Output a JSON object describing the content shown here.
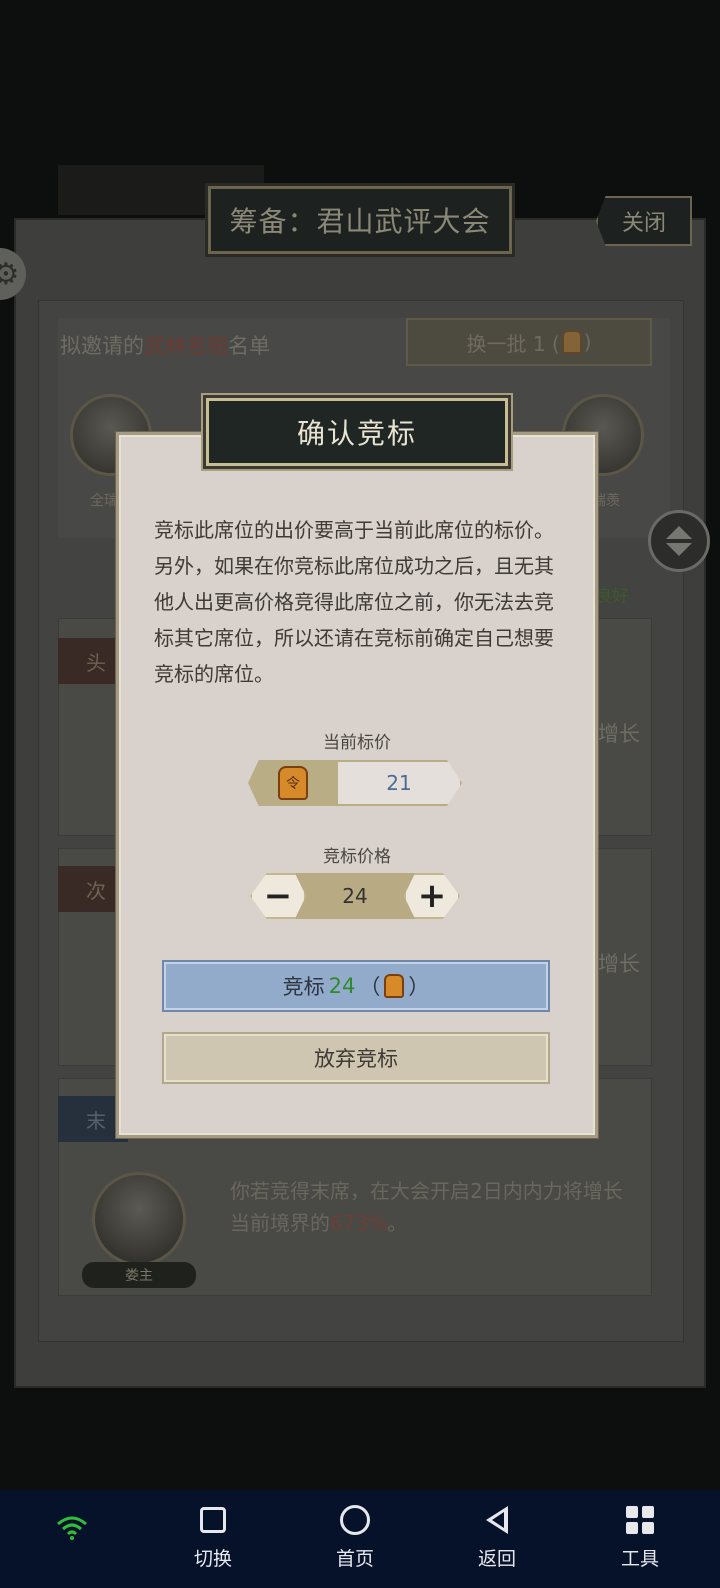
{
  "background": {
    "title": "筹备：君山武评大会",
    "close_label": "关闭",
    "invite_prefix": "拟邀请的",
    "invite_highlight": "武林名宿",
    "invite_suffix": "名单",
    "refresh_label": "换一批 1 (",
    "refresh_close": ")",
    "avatar_left_name": "全瑞",
    "avatar_right_name": "瑞羡",
    "status_label": "：",
    "status_value": "良好",
    "section_head_tag": "头",
    "section_second_tag": "次",
    "section_end_tag": "末",
    "grow_text_1": "增长",
    "grow_text_2": "增长",
    "end_desc_line1": "你若竞得末席，在大会开启2日内内力将增长",
    "end_desc_line2_prefix": "当前境界的",
    "end_desc_percent": "673%",
    "end_desc_line2_suffix": "。",
    "end_avatar_name": "娄主"
  },
  "modal": {
    "title": "确认竞标",
    "description": "竞标此席位的出价要高于当前此席位的标价。另外，如果在你竞标此席位成功之后，且无其他人出更高价格竞得此席位之前，你无法去竞标其它席位，所以还请在竞标前确定自己想要竞标的席位。",
    "current_price_label": "当前标价",
    "current_price_value": "21",
    "bid_price_label": "竞标价格",
    "bid_price_value": "24",
    "minus_symbol": "−",
    "plus_symbol": "+",
    "bid_button_prefix": "竞标",
    "bid_button_amount": "24",
    "bid_button_paren_open": "（",
    "bid_button_paren_close": "）",
    "give_up_label": "放弃竞标",
    "currency_icon": "gold-token-icon"
  },
  "navbar": {
    "switch_label": "切换",
    "home_label": "首页",
    "back_label": "返回",
    "tools_label": "工具"
  },
  "colors": {
    "bid_button": "#93abcb",
    "status_good": "#3f5a2a",
    "bid_amount": "#2e8a2e",
    "percent": "#6e3e36"
  }
}
